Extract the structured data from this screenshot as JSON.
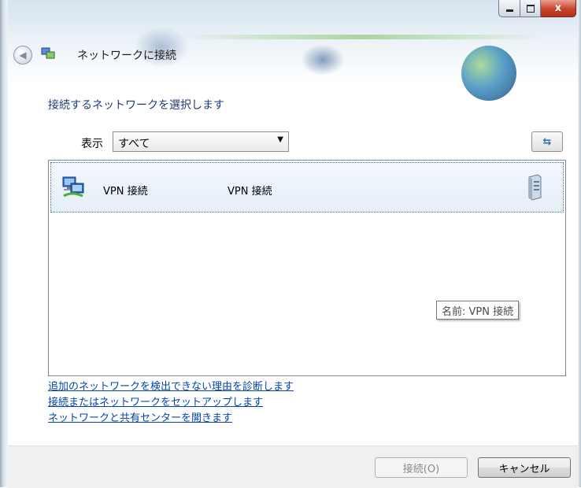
{
  "window": {
    "title": "ネットワークに接続",
    "buttons": {
      "minimize": "—",
      "maximize": "□",
      "close": "x"
    }
  },
  "header": {
    "back_label": "◀"
  },
  "instruction": "接続するネットワークを選択します",
  "filter": {
    "label": "表示",
    "selected": "すべて"
  },
  "refresh_label": "⇆",
  "networks": [
    {
      "name": "VPN 接続",
      "type": "VPN 接続",
      "icon": "vpn-network-icon",
      "status_icon": "server-icon"
    }
  ],
  "tooltip": "名前: VPN 接続",
  "links": [
    "追加のネットワークを検出できない理由を診断します",
    "接続またはネットワークをセットアップします",
    "ネットワークと共有センターを開きます"
  ],
  "footer": {
    "connect": "接続(O)",
    "cancel": "キャンセル"
  },
  "colors": {
    "instruction": "#1f3a7a",
    "link": "#0645ad",
    "selection_bg": "#e4eef7",
    "close_button": "#c9412a"
  }
}
